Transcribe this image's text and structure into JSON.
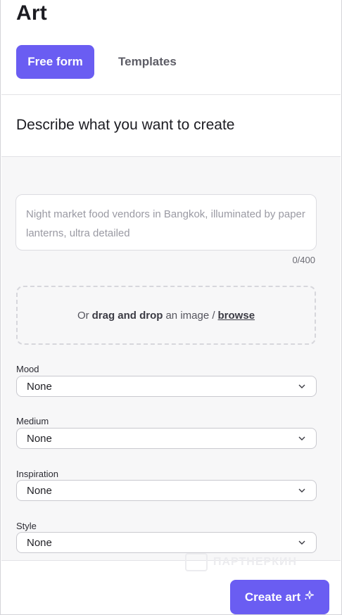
{
  "app": {
    "title": "Art"
  },
  "tabs": [
    {
      "label": "Free form",
      "active": true
    },
    {
      "label": "Templates",
      "active": false
    }
  ],
  "section": {
    "heading": "Describe what you want to create"
  },
  "prompt": {
    "placeholder": "Night market food vendors in Bangkok, illuminated by paper lanterns, ultra detailed",
    "value": "",
    "counter": "0/400"
  },
  "dropzone": {
    "prefix": "Or",
    "bold": "drag and drop",
    "middle": "an image /",
    "link": "browse"
  },
  "fields": [
    {
      "label": "Mood",
      "value": "None"
    },
    {
      "label": "Medium",
      "value": "None"
    },
    {
      "label": "Inspiration",
      "value": "None"
    },
    {
      "label": "Style",
      "value": "None"
    }
  ],
  "watermark": {
    "text": "ПАРТНЕРКИН"
  },
  "actions": {
    "create_label": "Create art",
    "create_icon": "sparkle-icon"
  },
  "colors": {
    "accent": "#6a5df2"
  }
}
